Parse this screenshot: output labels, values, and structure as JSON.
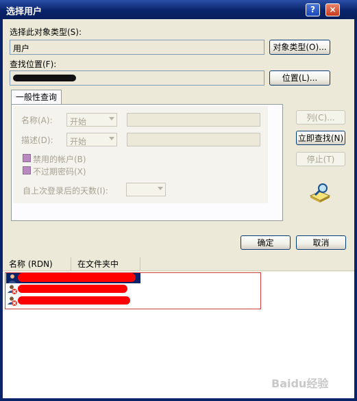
{
  "window": {
    "title": "选择用户",
    "help_label": "?",
    "close_label": "×"
  },
  "object_type": {
    "label": "选择此对象类型(S):",
    "value": "用户",
    "button": "对象类型(O)..."
  },
  "location": {
    "label": "查找位置(F):",
    "button": "位置(L)..."
  },
  "tab": {
    "label": "一般性查询"
  },
  "query": {
    "name_label": "名称(A):",
    "name_combo": "开始",
    "desc_label": "描述(D):",
    "desc_combo": "开始",
    "disabled_accounts": "禁用的帐户(B)",
    "non_expiring_pw": "不过期密码(X)",
    "days_since_login": "自上次登录后的天数(I):"
  },
  "side_buttons": {
    "columns": "列(C)...",
    "find_now": "立即查找(N)",
    "stop": "停止(T)"
  },
  "dialog_buttons": {
    "ok": "确定",
    "cancel": "取消"
  },
  "results": {
    "columns": [
      "名称 (RDN)",
      "在文件夹中"
    ],
    "rows": [
      {
        "icon": "user-icon",
        "disabled": false
      },
      {
        "icon": "disabled-user-icon",
        "disabled": true
      },
      {
        "icon": "disabled-user-icon",
        "disabled": true
      }
    ]
  },
  "watermark": "Baidu经验",
  "colors": {
    "title_bar": "#0a246a",
    "dialog_bg": "#ece9d8",
    "redaction": "#ff0000",
    "selection_border": "#d23c3c",
    "checkbox": "#b88ac0"
  }
}
